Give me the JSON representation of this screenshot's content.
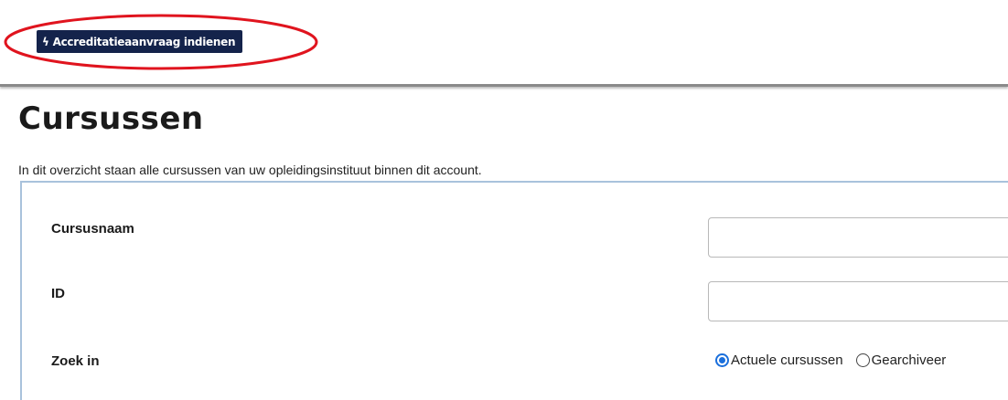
{
  "toolbar": {
    "accreditation_button_label": "Accreditatieaanvraag indienen",
    "accreditation_button_icon": "lightning-bolt-icon",
    "highlight_color": "#e0141e",
    "button_color": "#14234b"
  },
  "page": {
    "title": "Cursussen",
    "intro": "In dit overzicht staan alle cursussen van uw opleidingsinstituut binnen dit account."
  },
  "filter": {
    "course_name_label": "Cursusnaam",
    "course_name_value": "",
    "id_label": "ID",
    "id_value": "",
    "search_in_label": "Zoek in",
    "options": [
      {
        "label": "Actuele cursussen",
        "selected": true
      },
      {
        "label": "Gearchiveer",
        "selected": false
      }
    ],
    "panel_border_color": "#a9c2dc"
  }
}
